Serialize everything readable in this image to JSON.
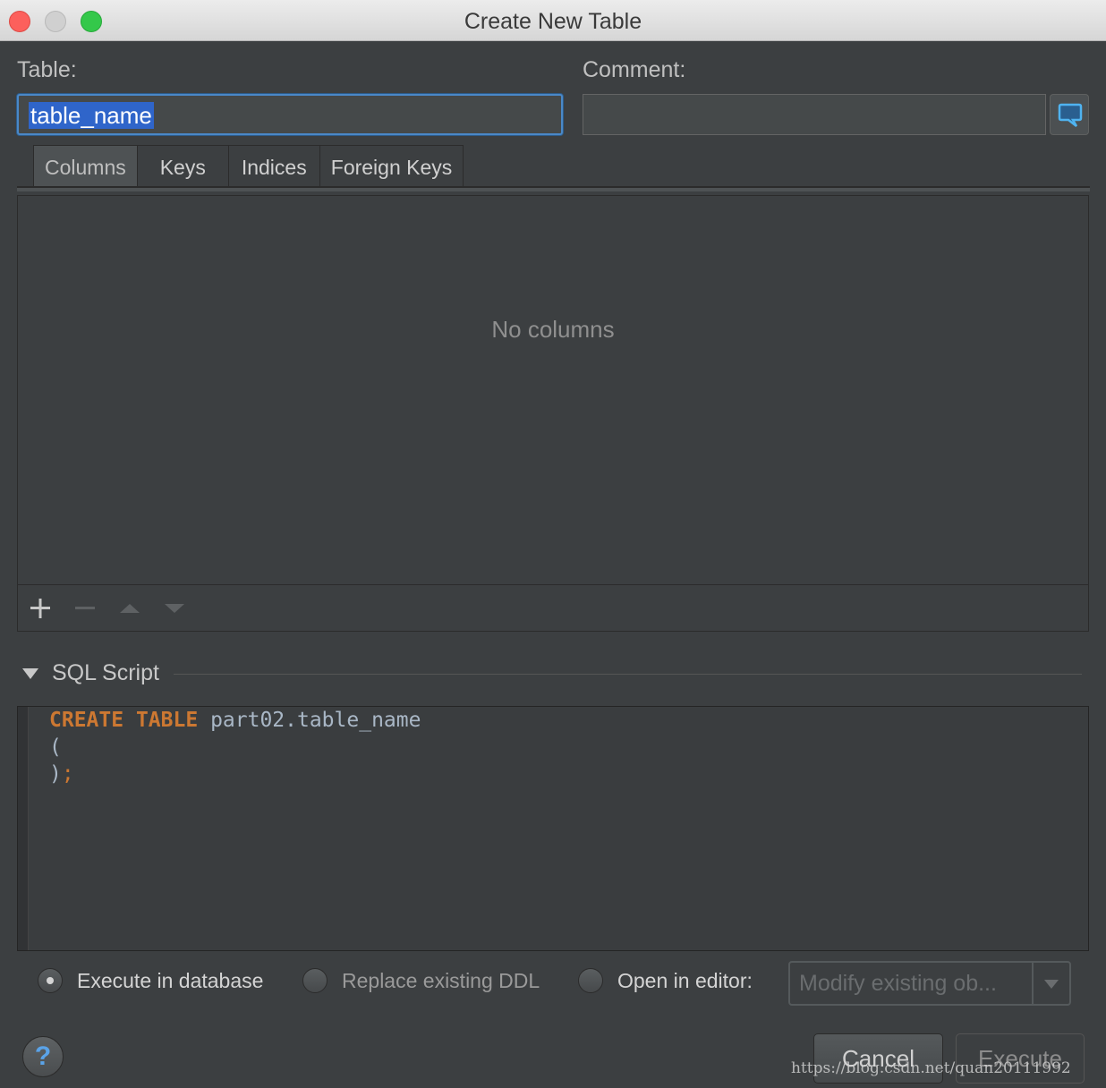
{
  "window": {
    "title": "Create New Table"
  },
  "form": {
    "table_label": "Table:",
    "table_value": "table_name",
    "comment_label": "Comment:",
    "comment_value": ""
  },
  "tabs": [
    {
      "label": "Columns",
      "active": true
    },
    {
      "label": "Keys",
      "active": false
    },
    {
      "label": "Indices",
      "active": false
    },
    {
      "label": "Foreign Keys",
      "active": false
    }
  ],
  "columns_panel": {
    "empty_text": "No columns"
  },
  "sql_section": {
    "title": "SQL Script",
    "keyword_create": "CREATE",
    "keyword_table": "TABLE",
    "identifier": "part02.table_name",
    "open_paren": "(",
    "close_paren": ")",
    "semicolon": ";"
  },
  "options": {
    "execute_in_db": "Execute in database",
    "replace_ddl": "Replace existing DDL",
    "open_in_editor": "Open in editor:",
    "selected": "execute_in_db",
    "editor_mode_value": "Modify existing ob..."
  },
  "buttons": {
    "help": "?",
    "cancel": "Cancel",
    "execute": "Execute"
  },
  "watermark": "https://blog.csdn.net/quan20111992",
  "colors": {
    "background": "#3c3f41",
    "accent": "#4a88c7",
    "selection": "#2f65ca",
    "keyword": "#cc7832",
    "code_text": "#a9b7c6"
  }
}
